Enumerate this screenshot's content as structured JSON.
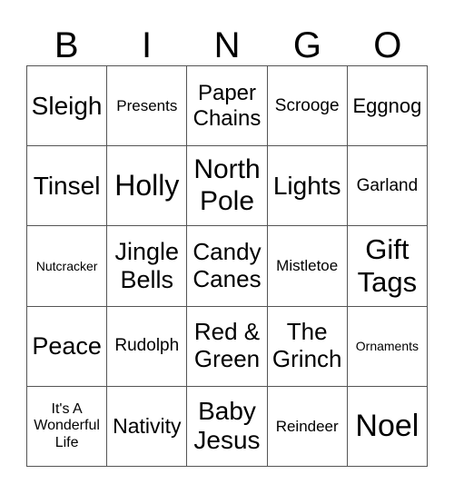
{
  "header": [
    "B",
    "I",
    "N",
    "G",
    "O"
  ],
  "cells": [
    "Sleigh",
    "Presents",
    "Paper Chains",
    "Scrooge",
    "Eggnog",
    "Tinsel",
    "Holly",
    "North Pole",
    "Lights",
    "Garland",
    "Nutcracker",
    "Jingle Bells",
    "Candy Canes",
    "Mistletoe",
    "Gift Tags",
    "Peace",
    "Rudolph",
    "Red & Green",
    "The Grinch",
    "Ornaments",
    "It's A Wonderful Life",
    "Nativity",
    "Baby Jesus",
    "Reindeer",
    "Noel"
  ]
}
